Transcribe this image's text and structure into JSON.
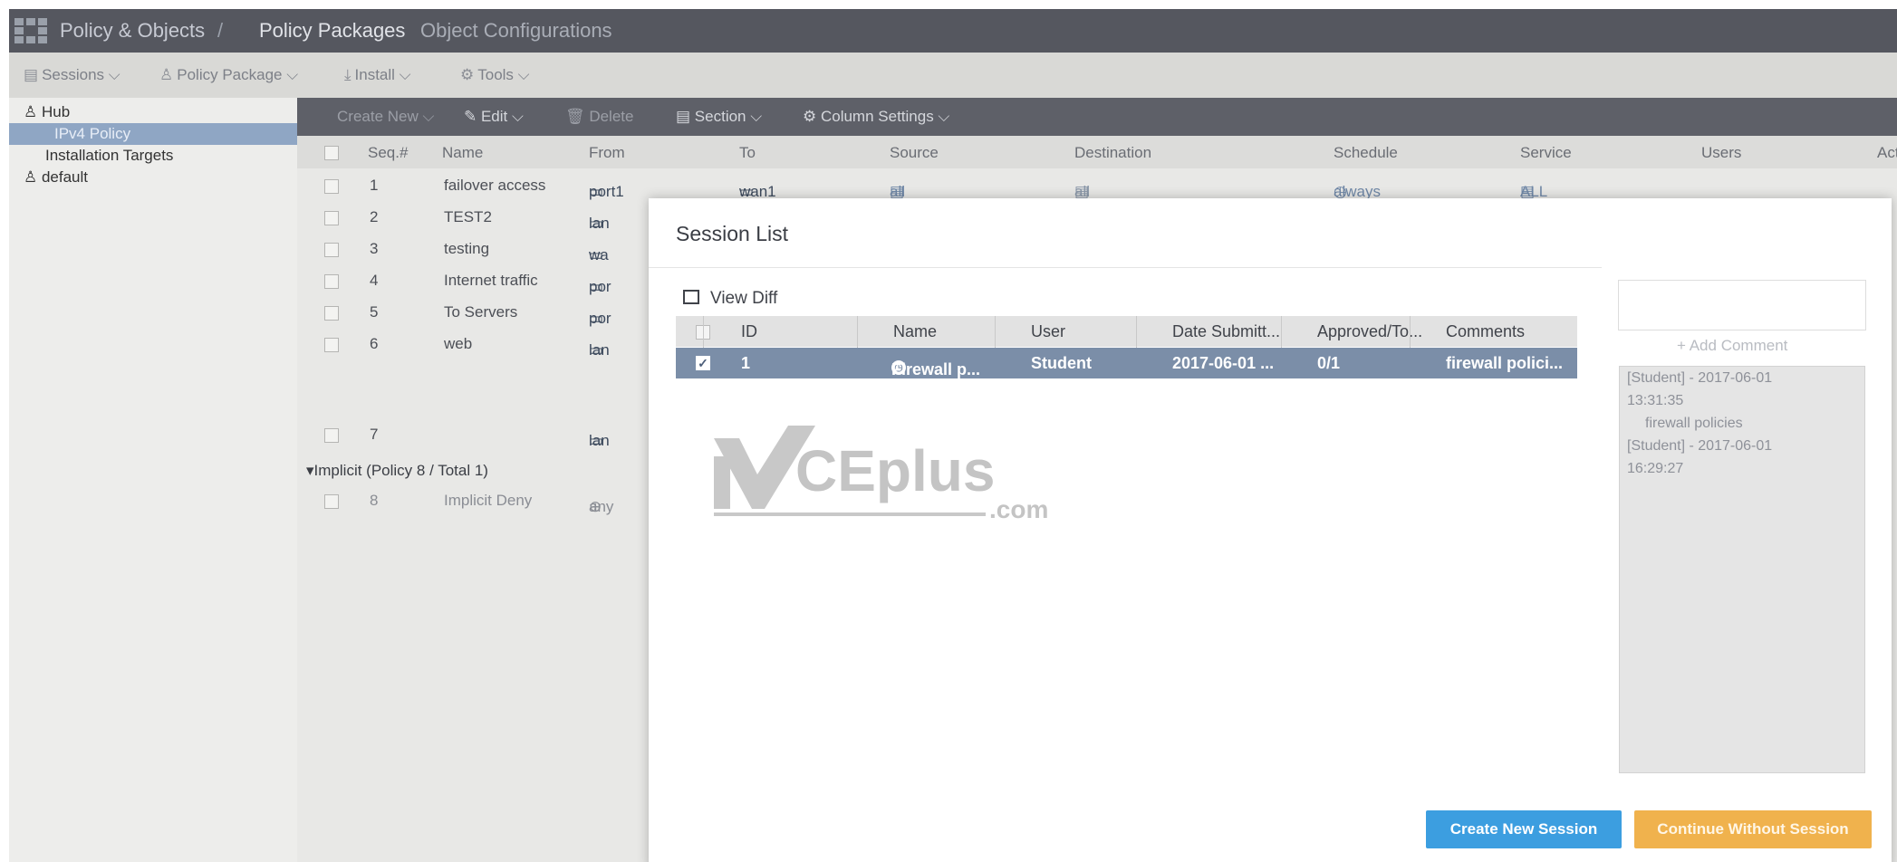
{
  "topbar": {
    "crumb1": "Policy & Objects",
    "sep": "/",
    "crumb2": "Policy Packages",
    "crumb3": "Object Configurations"
  },
  "toolbar": {
    "sessions": "Sessions",
    "policy_package": "Policy Package",
    "install": "Install",
    "tools": "Tools"
  },
  "sidebar": {
    "hub": "Hub",
    "ipv4_policy": "IPv4 Policy",
    "installation_targets": "Installation Targets",
    "default": "default"
  },
  "policy_toolbar": {
    "create_new": "Create New",
    "edit": "Edit",
    "delete": "Delete",
    "section": "Section",
    "column_settings": "Column Settings"
  },
  "policy_table": {
    "columns": [
      "Seq.#",
      "Name",
      "From",
      "To",
      "Source",
      "Destination",
      "Schedule",
      "Service",
      "Users",
      "Act"
    ],
    "rows": [
      {
        "seq": "1",
        "name": "failover access",
        "from": "port1",
        "to": "wan1",
        "source": "all",
        "destination": "all",
        "schedule": "always",
        "service": "ALL"
      },
      {
        "seq": "2",
        "name": "TEST2",
        "from": "lan"
      },
      {
        "seq": "3",
        "name": "testing",
        "from": "wa"
      },
      {
        "seq": "4",
        "name": "Internet traffic",
        "from": "por"
      },
      {
        "seq": "5",
        "name": "To Servers",
        "from": "por"
      },
      {
        "seq": "6",
        "name": "web",
        "from": "lan"
      },
      {
        "seq": "7",
        "name": "",
        "from": "lan"
      }
    ],
    "implicit_section": "Implicit (Policy 8 / Total 1)",
    "implicit_row": {
      "seq": "8",
      "name": "Implicit Deny",
      "from": "any"
    }
  },
  "session_list": {
    "title": "Session List",
    "view_diff": "View Diff",
    "columns": [
      "ID",
      "Name",
      "User",
      "Date Submitt...",
      "Approved/To...",
      "Comments"
    ],
    "row": {
      "id": "1",
      "name": "Firewall p...",
      "user": "Student",
      "date": "2017-06-01 ...",
      "approved": "0/1",
      "comments": "firewall polici..."
    },
    "add_comment": "Add Comment",
    "comment_lines": [
      "[Student] - 2017-06-01",
      "13:31:35",
      "firewall policies",
      "[Student] - 2017-06-01",
      "16:29:27"
    ],
    "create_new_session": "Create New Session",
    "continue_without_session": "Continue Without Session"
  },
  "watermark": {
    "main": "CEplus",
    "sub": ".com"
  },
  "colors": {
    "accent_blue": "#3c9ee0",
    "accent_orange": "#f0b24d",
    "selection": "#7b8ea8"
  }
}
